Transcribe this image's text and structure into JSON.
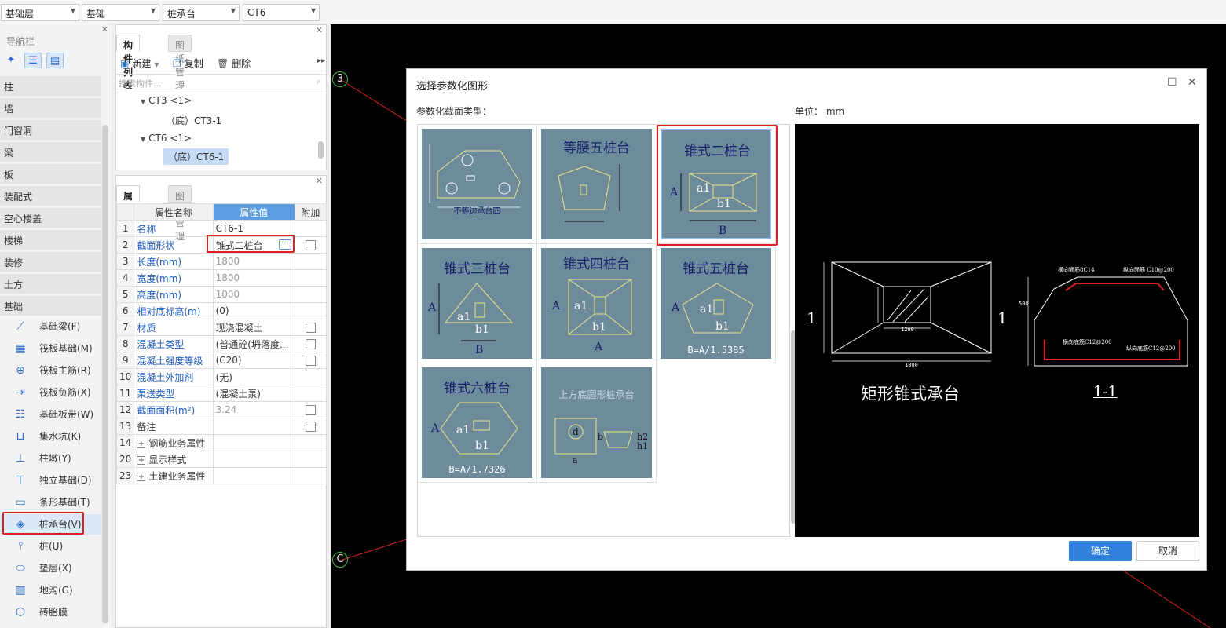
{
  "toolbar": {
    "floor": "基础层",
    "category": "基础",
    "type": "桩承台",
    "component": "CT6"
  },
  "nav": {
    "title": "导航栏",
    "categories": [
      "柱",
      "墙",
      "门窗洞",
      "梁",
      "板",
      "装配式",
      "空心楼盖",
      "楼梯",
      "装修",
      "土方",
      "基础"
    ],
    "items": [
      {
        "label": "基础梁(F)",
        "icon": "beam-icon"
      },
      {
        "label": "筏板基础(M)",
        "icon": "grid-slab-icon"
      },
      {
        "label": "筏板主筋(R)",
        "icon": "rebar-icon"
      },
      {
        "label": "筏板负筋(X)",
        "icon": "neg-rebar-icon"
      },
      {
        "label": "基础板带(W)",
        "icon": "strip-icon"
      },
      {
        "label": "集水坑(K)",
        "icon": "pit-icon"
      },
      {
        "label": "柱墩(Y)",
        "icon": "column-pier-icon"
      },
      {
        "label": "独立基础(D)",
        "icon": "isolated-footing-icon"
      },
      {
        "label": "条形基础(T)",
        "icon": "strip-footing-icon"
      },
      {
        "label": "桩承台(V)",
        "icon": "pile-cap-icon"
      },
      {
        "label": "桩(U)",
        "icon": "pile-icon"
      },
      {
        "label": "垫层(X)",
        "icon": "cushion-icon"
      },
      {
        "label": "地沟(G)",
        "icon": "trench-icon"
      },
      {
        "label": "砖胎膜",
        "icon": "brick-mold-icon"
      }
    ]
  },
  "complist": {
    "tab_active": "构件列表",
    "tab_other": "图纸管理",
    "new_label": "新建",
    "copy_label": "复制",
    "delete_label": "删除",
    "search_placeholder": "搜索构件...",
    "tree": [
      {
        "label": "CT3 <1>",
        "level": 0
      },
      {
        "label": "（底）CT3-1",
        "level": 1
      },
      {
        "label": "CT6 <1>",
        "level": 0
      },
      {
        "label": "（底）CT6-1",
        "level": 1,
        "selected": true
      }
    ]
  },
  "props": {
    "tab_active": "属性列表",
    "tab_other": "图层管理",
    "col_name": "属性名称",
    "col_value": "属性值",
    "col_extra": "附加",
    "rows": [
      {
        "no": "1",
        "name": "名称",
        "value": "CT6-1",
        "check": false,
        "gray": false
      },
      {
        "no": "2",
        "name": "截面形状",
        "value": "锥式二桩台",
        "check": true,
        "gray": false
      },
      {
        "no": "3",
        "name": "长度(mm)",
        "value": "1800",
        "check": false,
        "gray": true
      },
      {
        "no": "4",
        "name": "宽度(mm)",
        "value": "1800",
        "check": false,
        "gray": true
      },
      {
        "no": "5",
        "name": "高度(mm)",
        "value": "1000",
        "check": false,
        "gray": true
      },
      {
        "no": "6",
        "name": "相对底标高(m)",
        "value": "(0)",
        "check": false,
        "gray": false
      },
      {
        "no": "7",
        "name": "材质",
        "value": "现浇混凝土",
        "check": true,
        "gray": false
      },
      {
        "no": "8",
        "name": "混凝土类型",
        "value": "(普通砼(坍落度...",
        "check": true,
        "gray": false
      },
      {
        "no": "9",
        "name": "混凝土强度等级",
        "value": "(C20)",
        "check": true,
        "gray": false
      },
      {
        "no": "10",
        "name": "混凝土外加剂",
        "value": "(无)",
        "check": false,
        "gray": false
      },
      {
        "no": "11",
        "name": "泵送类型",
        "value": "(混凝土泵)",
        "check": false,
        "gray": false
      },
      {
        "no": "12",
        "name": "截面面积(m²)",
        "value": "3.24",
        "check": true,
        "gray": true
      },
      {
        "no": "13",
        "name": "备注",
        "value": "",
        "check": true,
        "gray": false
      },
      {
        "no": "14",
        "name": "钢筋业务属性",
        "value": "",
        "check": false,
        "gray": false,
        "group": true
      },
      {
        "no": "20",
        "name": "显示样式",
        "value": "",
        "check": false,
        "gray": false,
        "group": true
      },
      {
        "no": "23",
        "name": "土建业务属性",
        "value": "",
        "check": false,
        "gray": false,
        "group": true
      }
    ]
  },
  "canvas": {
    "axis_3": "3",
    "axis_c": "C"
  },
  "dialog": {
    "title": "选择参数化图形",
    "type_label": "参数化截面类型：",
    "unit_label": "单位：  mm",
    "ok": "确定",
    "cancel": "取消",
    "shapes": [
      {
        "name": "",
        "caption": "不等边承台四"
      },
      {
        "name": "等腰五桩台",
        "caption": ""
      },
      {
        "name": "锥式二桩台",
        "caption": "",
        "selected": true
      },
      {
        "name": "锥式三桩台",
        "caption": ""
      },
      {
        "name": "锥式四桩台",
        "caption": ""
      },
      {
        "name": "锥式五桩台",
        "caption": "B=A/1.5385"
      },
      {
        "name": "锥式六桩台",
        "caption": "B=A/1.7326"
      },
      {
        "name": "上方底圆形桩承台",
        "caption": ""
      }
    ],
    "preview": {
      "title": "矩形锥式承台",
      "section": "1-1",
      "mark_left": "1",
      "mark_right": "1",
      "dim_1800": "1800",
      "dim_1200": "1200",
      "dim_500": "500",
      "label_top1": "横向面筋8C14",
      "label_top2": "纵向面筋 C10@200",
      "label_bot1": "横向底筋C12@200",
      "label_bot2": "纵向底筋C12@200"
    }
  }
}
